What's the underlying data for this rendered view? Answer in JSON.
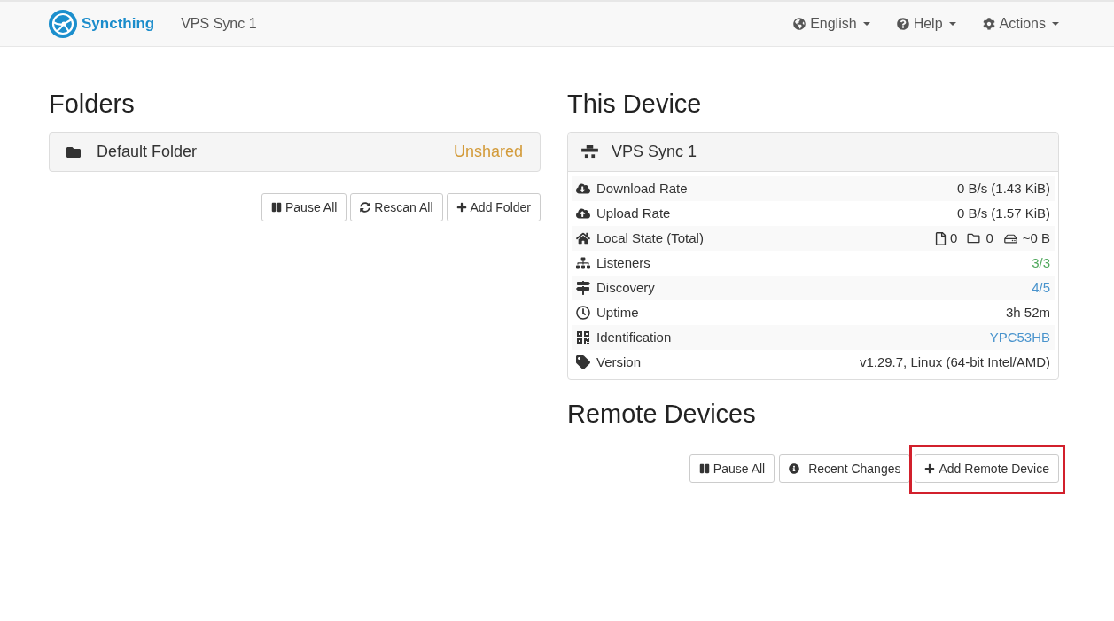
{
  "navbar": {
    "brand": "Syncthing",
    "device_name": "VPS Sync 1",
    "menus": [
      {
        "label": "English"
      },
      {
        "label": "Help"
      },
      {
        "label": "Actions"
      }
    ]
  },
  "folders": {
    "title": "Folders",
    "items": [
      {
        "name": "Default Folder",
        "status": "Unshared",
        "color": "#d39b3a"
      }
    ],
    "buttons": [
      {
        "label": "Pause All"
      },
      {
        "label": "Rescan All"
      },
      {
        "label": "Add Folder"
      }
    ]
  },
  "this_device": {
    "title": "This Device",
    "name": "VPS Sync 1",
    "rows": [
      {
        "kind": "text",
        "label": "Download Rate",
        "value": "0 B/s (1.43 KiB)"
      },
      {
        "kind": "text",
        "label": "Upload Rate",
        "value": "0 B/s (1.57 KiB)"
      },
      {
        "kind": "counts",
        "label": "Local State (Total)",
        "files": "0",
        "folders": "0",
        "size": "~0 B"
      },
      {
        "kind": "text",
        "label": "Listeners",
        "value": "3/3",
        "color": "#4fa85c"
      },
      {
        "kind": "text",
        "label": "Discovery",
        "value": "4/5",
        "color": "#4a94cd"
      },
      {
        "kind": "text",
        "label": "Uptime",
        "value": "3h 52m"
      },
      {
        "kind": "text",
        "label": "Identification",
        "value": "YPC53HB",
        "color": "#4a94cd"
      },
      {
        "kind": "text",
        "label": "Version",
        "value": "v1.29.7, Linux (64-bit Intel/AMD)"
      }
    ]
  },
  "remote_devices": {
    "title": "Remote Devices",
    "buttons": [
      {
        "label": "Pause All",
        "highlighted": false
      },
      {
        "label": "Recent Changes",
        "highlighted": false
      },
      {
        "label": "Add Remote Device",
        "highlighted": true
      }
    ]
  }
}
